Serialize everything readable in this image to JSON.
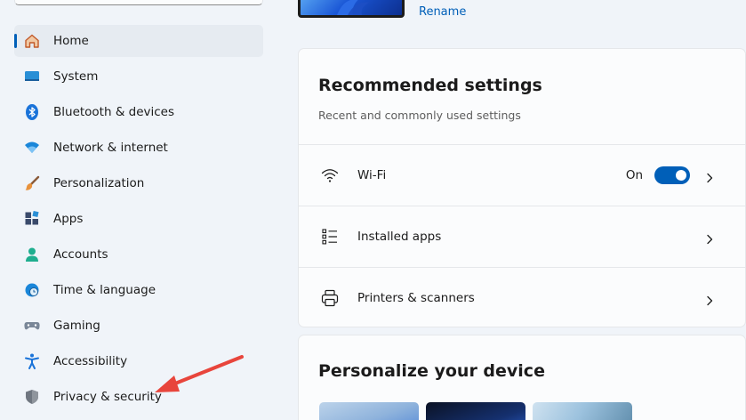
{
  "sidebar": {
    "items": [
      {
        "label": "Home",
        "icon": "home-icon",
        "selected": true
      },
      {
        "label": "System",
        "icon": "system-icon"
      },
      {
        "label": "Bluetooth & devices",
        "icon": "bluetooth-icon"
      },
      {
        "label": "Network & internet",
        "icon": "network-icon"
      },
      {
        "label": "Personalization",
        "icon": "brush-icon"
      },
      {
        "label": "Apps",
        "icon": "apps-icon"
      },
      {
        "label": "Accounts",
        "icon": "accounts-icon"
      },
      {
        "label": "Time & language",
        "icon": "time-language-icon"
      },
      {
        "label": "Gaming",
        "icon": "gaming-icon"
      },
      {
        "label": "Accessibility",
        "icon": "accessibility-icon"
      },
      {
        "label": "Privacy & security",
        "icon": "shield-icon"
      }
    ]
  },
  "device": {
    "rename_label": "Rename"
  },
  "recommended": {
    "title": "Recommended settings",
    "subtitle": "Recent and commonly used settings",
    "rows": [
      {
        "label": "Wi-Fi",
        "icon": "wifi-icon",
        "toggle_state": "On",
        "toggle_on": true
      },
      {
        "label": "Installed apps",
        "icon": "list-icon"
      },
      {
        "label": "Printers & scanners",
        "icon": "printer-icon"
      }
    ]
  },
  "personalize": {
    "title": "Personalize your device"
  },
  "colors": {
    "accent": "#005fb8",
    "annotation_arrow": "#e8453c"
  }
}
